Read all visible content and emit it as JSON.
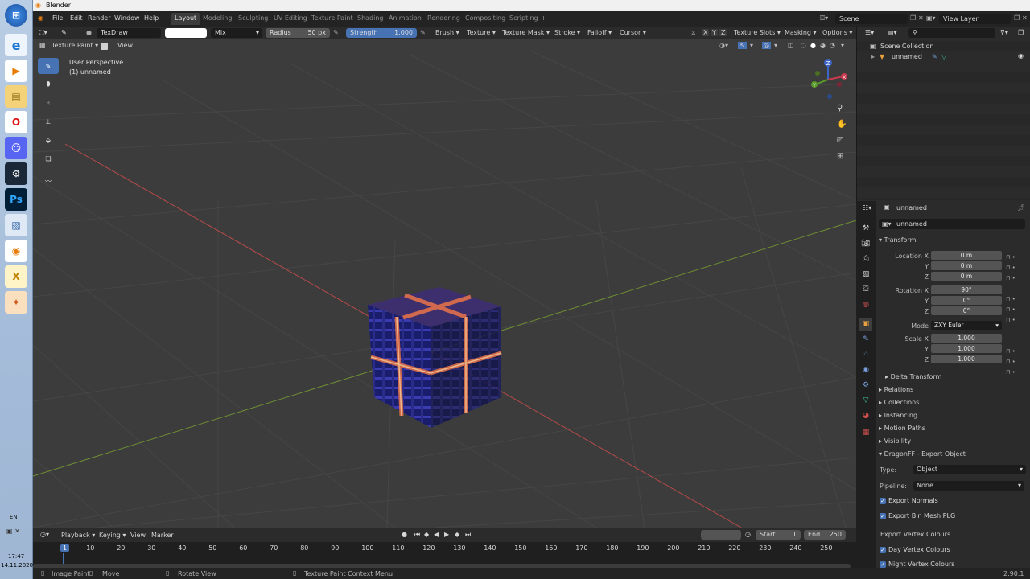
{
  "app": {
    "title": "Blender",
    "version": "2.90.1"
  },
  "menu": [
    "File",
    "Edit",
    "Render",
    "Window",
    "Help"
  ],
  "workspaces": [
    "Layout",
    "Modeling",
    "Sculpting",
    "UV Editing",
    "Texture Paint",
    "Shading",
    "Animation",
    "Rendering",
    "Compositing",
    "Scripting"
  ],
  "active_workspace": "Layout",
  "scene": {
    "scene_name": "Scene",
    "view_layer": "View Layer"
  },
  "tool_header": {
    "brush_name": "TexDraw",
    "blend_mode": "Mix",
    "radius_label": "Radius",
    "radius_value": "50 px",
    "strength_label": "Strength",
    "strength_value": "1.000",
    "menus": [
      "Brush",
      "Texture",
      "Texture Mask",
      "Stroke",
      "Falloff",
      "Cursor"
    ],
    "axes": [
      "X",
      "Y",
      "Z"
    ],
    "right_menus": [
      "Texture Slots",
      "Masking",
      "Options"
    ]
  },
  "viewport_header": {
    "mode": "Texture Paint",
    "view": "View"
  },
  "viewport": {
    "perspective": "User Perspective",
    "object": "(1) unnamed"
  },
  "gizmo": {
    "x": "X",
    "y": "Y",
    "z": "Z"
  },
  "tools": [
    "brush-icon",
    "fill-icon",
    "smear-icon",
    "clone-icon",
    "fill-bucket-icon",
    "mask-icon",
    "annotate-icon"
  ],
  "outliner": {
    "scene_collection": "Scene Collection",
    "object": "unnamed"
  },
  "properties": {
    "object_name": "unnamed",
    "data_name": "unnamed",
    "transform": "Transform",
    "location": {
      "label": "Location X",
      "y": "Y",
      "z": "Z",
      "values": [
        "0 m",
        "0 m",
        "0 m"
      ]
    },
    "rotation": {
      "label": "Rotation X",
      "y": "Y",
      "z": "Z",
      "values": [
        "90°",
        "0°",
        "0°"
      ]
    },
    "mode": {
      "label": "Mode",
      "value": "ZXY Euler"
    },
    "scale": {
      "label": "Scale X",
      "y": "Y",
      "z": "Z",
      "values": [
        "1.000",
        "1.000",
        "1.000"
      ]
    },
    "sections": [
      "Delta Transform",
      "Relations",
      "Collections",
      "Instancing",
      "Motion Paths",
      "Visibility",
      "DragonFF - Export Object"
    ],
    "export": {
      "type_label": "Type:",
      "type_value": "Object",
      "pipeline_label": "Pipeline:",
      "pipeline_value": "None",
      "export_normals": "Export Normals",
      "export_bin_mesh": "Export Bin Mesh PLG",
      "vertex_colours": "Export Vertex Colours",
      "day_vc": "Day Vertex Colours",
      "night_vc": "Night Vertex Colours"
    }
  },
  "timeline": {
    "menus": [
      "Playback",
      "Keying",
      "View",
      "Marker"
    ],
    "current_frame": "1",
    "start_label": "Start",
    "start": "1",
    "end_label": "End",
    "end": "250",
    "ticks": [
      "1",
      "10",
      "20",
      "30",
      "40",
      "50",
      "60",
      "70",
      "80",
      "90",
      "100",
      "110",
      "120",
      "130",
      "140",
      "150",
      "160",
      "170",
      "180",
      "190",
      "200",
      "210",
      "220",
      "230",
      "240",
      "250"
    ]
  },
  "status": {
    "image_paint": "Image Paint",
    "move": "Move",
    "rotate_view": "Rotate View",
    "context_menu": "Texture Paint Context Menu"
  },
  "taskbar": {
    "language": "EN",
    "time": "17:47",
    "date": "14.11.2020"
  },
  "colors": {
    "accent": "#4772b3",
    "x_axis": "#b84a4a",
    "y_axis": "#6e8f33"
  }
}
